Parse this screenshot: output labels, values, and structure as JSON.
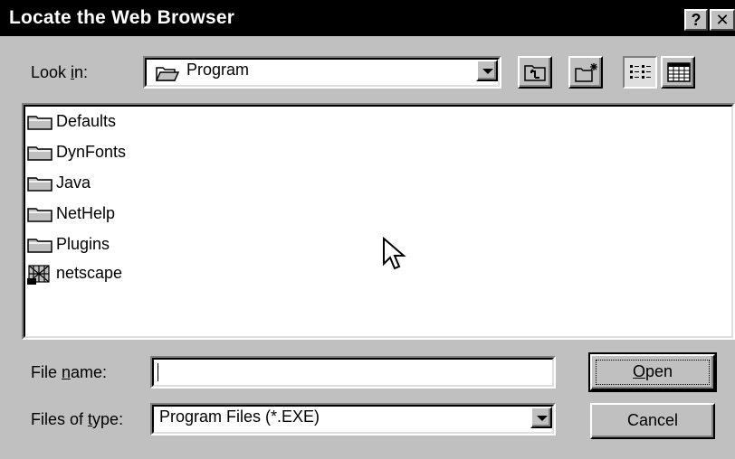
{
  "window": {
    "title": "Locate the Web Browser",
    "help_glyph": "?",
    "close_glyph": "✕"
  },
  "lookin": {
    "label_pre": "Look ",
    "label_accel": "i",
    "label_post": "n:",
    "value": "Program",
    "icon": "open-folder-icon"
  },
  "toolbar": {
    "up_one_level": "up-folder-icon",
    "create_new_folder": "new-folder-icon",
    "list_view": "list-view-icon",
    "details_view": "details-view-icon"
  },
  "files": [
    {
      "name": "Defaults",
      "icon": "folder-icon"
    },
    {
      "name": "DynFonts",
      "icon": "folder-icon"
    },
    {
      "name": "Java",
      "icon": "folder-icon"
    },
    {
      "name": "NetHelp",
      "icon": "folder-icon"
    },
    {
      "name": "Plugins",
      "icon": "folder-icon"
    },
    {
      "name": "netscape",
      "icon": "executable-icon"
    }
  ],
  "filename": {
    "label_pre": "File ",
    "label_accel": "n",
    "label_post": "ame:",
    "value": ""
  },
  "filetype": {
    "label_pre": "Files of ",
    "label_accel": "t",
    "label_post": "ype:",
    "value": "Program Files (*.EXE)"
  },
  "buttons": {
    "open_accel": "O",
    "open_rest": "pen",
    "cancel": "Cancel"
  },
  "colors": {
    "titlebar": "#000000",
    "face": "#c0c0c0",
    "window": "#ffffff"
  }
}
